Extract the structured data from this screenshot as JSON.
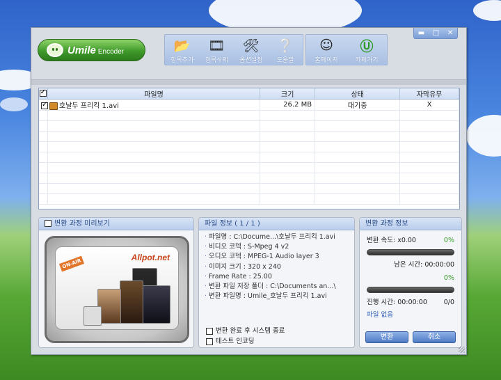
{
  "toolbar": {
    "items": [
      {
        "label": "항목추가",
        "icon": "add-folder-icon"
      },
      {
        "label": "항목삭제",
        "icon": "delete-item-icon"
      },
      {
        "label": "옵션설정",
        "icon": "options-tools-icon"
      },
      {
        "label": "도움말",
        "icon": "help-icon"
      }
    ],
    "links": [
      {
        "label": "홈페이지",
        "icon": "homepage-icon"
      },
      {
        "label": "카페가기",
        "icon": "cafe-icon"
      }
    ]
  },
  "logo": {
    "brand": "Umile",
    "sub": "Encoder"
  },
  "window_controls": {
    "minimize": "▬",
    "maximize": "□",
    "close": "✕"
  },
  "file_list": {
    "columns": [
      "파일명",
      "크기",
      "상태",
      "자막유무"
    ],
    "rows": [
      {
        "name": "호날두 프리킥 1.avi",
        "size": "26.2 MB",
        "status": "대기중",
        "subtitle": "X",
        "checked": true
      }
    ]
  },
  "preview": {
    "title": "변환 과정 미리보기",
    "badge": "ON-AIR",
    "brand": "Allpot.net"
  },
  "file_info": {
    "title": "파일 정보 ( 1 / 1 )",
    "lines": [
      "파일명 : C:\\Docume...\\호날두 프리킥 1.avi",
      "비디오 코덱 : S-Mpeg 4 v2",
      "오디오 코덱 : MPEG-1 Audio layer 3",
      "이미지 크기 : 320 x 240",
      "Frame Rate : 25.00",
      "변환 파일 저장 폴더 : C:\\Documents an...\\",
      "변환 파일명 : Umile_호날두 프리킥 1.avi"
    ],
    "options": [
      {
        "label": "변환 완료 후 시스템 종료",
        "checked": false
      },
      {
        "label": "테스트 인코딩",
        "checked": false
      }
    ]
  },
  "status": {
    "title": "변환 과정 정보",
    "speed_label": "변환 속도: x0.00",
    "speed_pct": "0%",
    "remaining": "남은 시간: 00:00:00",
    "progress_pct": "0%",
    "elapsed": "진행 시간: 00:00:00",
    "count": "0/0",
    "file_state": "파일 없음",
    "convert_button": "변환",
    "cancel_button": "취소"
  }
}
